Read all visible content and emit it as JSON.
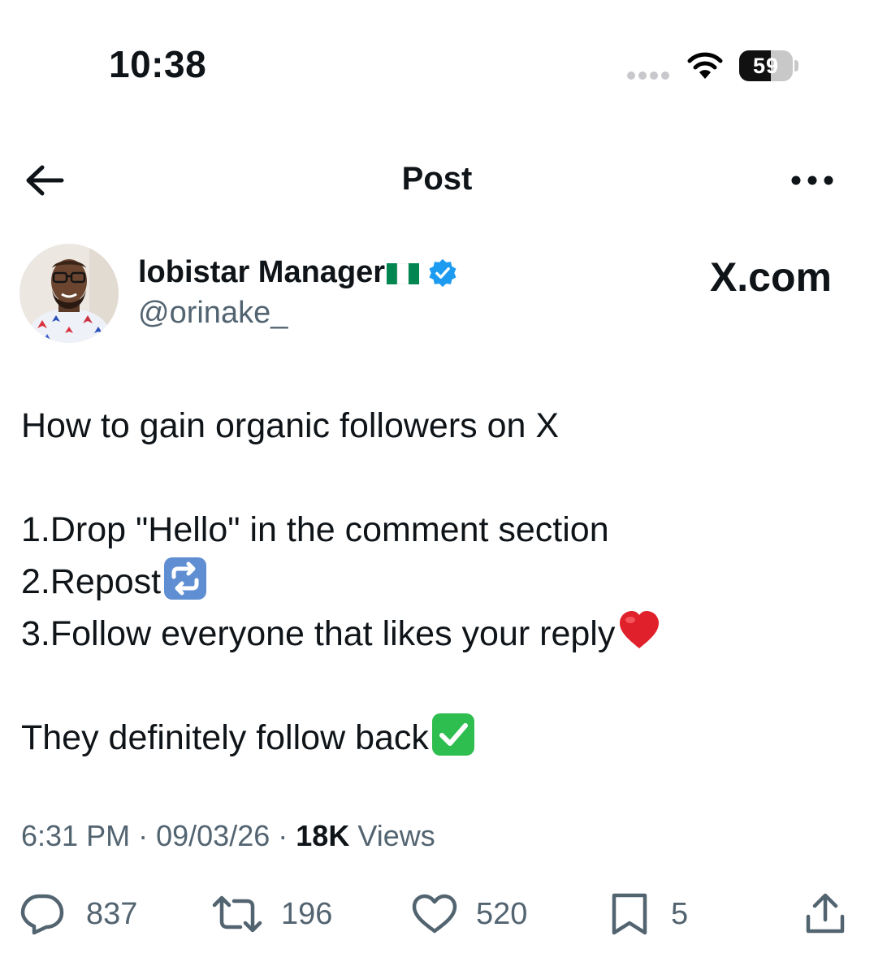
{
  "status_bar": {
    "time": "10:38",
    "battery": "59",
    "battery_fraction": 0.59
  },
  "header": {
    "title": "Post",
    "back_icon": "arrow-left-icon",
    "more_icon": "more-horizontal-icon"
  },
  "author": {
    "name": "lobistar Manager",
    "handle": "@orinake_",
    "verified_color": "#1d9bf0"
  },
  "watermark": "X.com",
  "post": {
    "line1": "How to gain organic followers on X",
    "line2": "1.Drop \"Hello\" in the comment section",
    "line3": "2.Repost",
    "line4": "3.Follow everyone that likes your reply",
    "line5": "They definitely follow back"
  },
  "meta": {
    "time": "6:31 PM",
    "date": "09/03/26",
    "views_count": "18K",
    "views_label": "Views",
    "separator": "·"
  },
  "actions": {
    "replies": "837",
    "reposts": "196",
    "likes": "520",
    "bookmarks": "5"
  },
  "colors": {
    "text": "#0f1419",
    "secondary": "#536471",
    "accent": "#1d9bf0"
  }
}
